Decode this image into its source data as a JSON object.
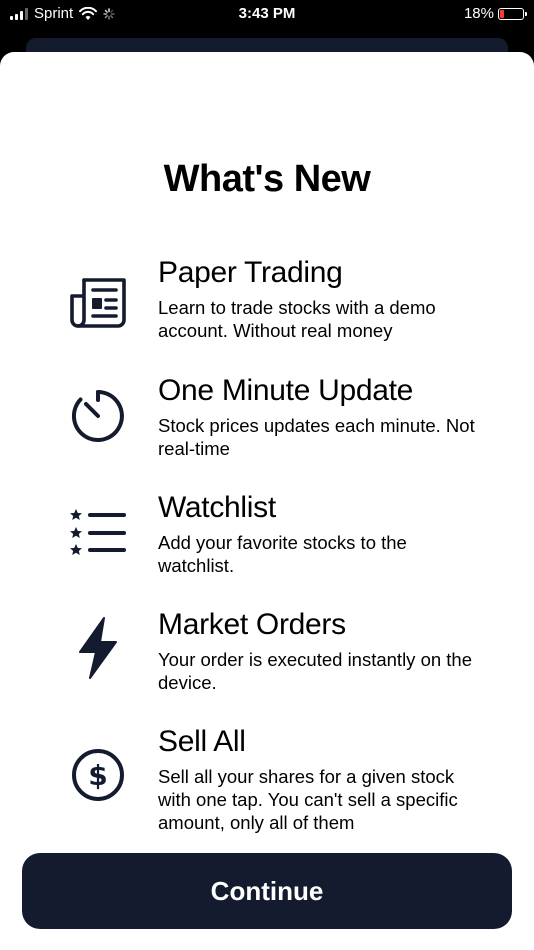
{
  "status_bar": {
    "carrier": "Sprint",
    "time": "3:43 PM",
    "battery": "18%",
    "battery_color": "#ff3b30"
  },
  "modal": {
    "title": "What's New",
    "features": [
      {
        "icon": "newspaper-icon",
        "title": "Paper Trading",
        "description": "Learn to trade stocks with a demo account. Without real money"
      },
      {
        "icon": "timer-icon",
        "title": "One Minute Update",
        "description": "Stock prices updates each minute. Not real-time"
      },
      {
        "icon": "starred-list-icon",
        "title": "Watchlist",
        "description": "Add your favorite stocks to the watchlist."
      },
      {
        "icon": "lightning-bolt-icon",
        "title": "Market Orders",
        "description": "Your order is executed instantly on the device."
      },
      {
        "icon": "dollar-circle-icon",
        "title": "Sell All",
        "description": "Sell all your shares for a given stock with one tap. You can't sell a specific amount, only all of them"
      }
    ],
    "continue_label": "Continue"
  },
  "colors": {
    "primary": "#141b2e",
    "background": "#ffffff"
  }
}
